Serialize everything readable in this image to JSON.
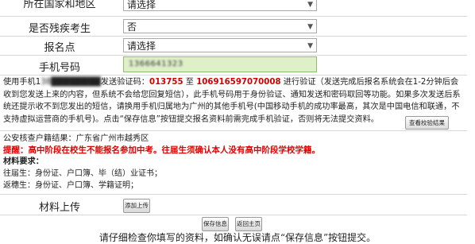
{
  "form": {
    "rows": [
      {
        "label": "所在国家和地区",
        "value": "请选择"
      },
      {
        "label": "是否残疾考生",
        "value": "否"
      },
      {
        "label": "报名点",
        "value": "请选择"
      },
      {
        "label": "手机号码",
        "value": "1366641323"
      }
    ]
  },
  "notice": {
    "prefix": "使用手机1",
    "masked": "38████████",
    "mid": "发送验证码：",
    "code": "013755",
    "to_text": " 至 ",
    "number": "106916597070008",
    "rest": " 进行验证（发送完成后报名系统会在1-2分钟后会收到您发送上来的内容，但系统不会给您回复短信），此手机号码用于身份验证、通知发送和密码取回等功能。如果多次发送后系统还提示收不到您发出的短信，请换用手机归属地为广州的其他手机号(中国移动手机的成功率最高，其次是中国电信和联通，不支持虚拟运营商的手机号)。点击“保存信息”按钮提交报名资料前需完成手机验证，否则将无法提交资料。",
    "check_button": "查看校验结果"
  },
  "verify": {
    "hukou_label": "公安核查户籍结果：广东省广州市越秀区",
    "warning": "提醒：高中阶段在校生不能报名参加中考。往届生须确认本人没有高中阶段学校学籍。",
    "materials_title": "材料要求：",
    "past_grad": "往届生：身份证、户口簿、毕（结）业证书；",
    "returnee": "返穗生：身份证、户口簿、学籍证明；"
  },
  "upload": {
    "label": "材料上传",
    "button": "添加上传"
  },
  "actions": {
    "save": "保存信息",
    "back": "返回主页"
  },
  "footer": "请仔细检查你填写的资料，如确认无误请点“保存信息”按钮提交。",
  "colors": {
    "warning_red": "#e00000",
    "code_red": "#d40000",
    "phone_bg": "#dff0c9"
  }
}
